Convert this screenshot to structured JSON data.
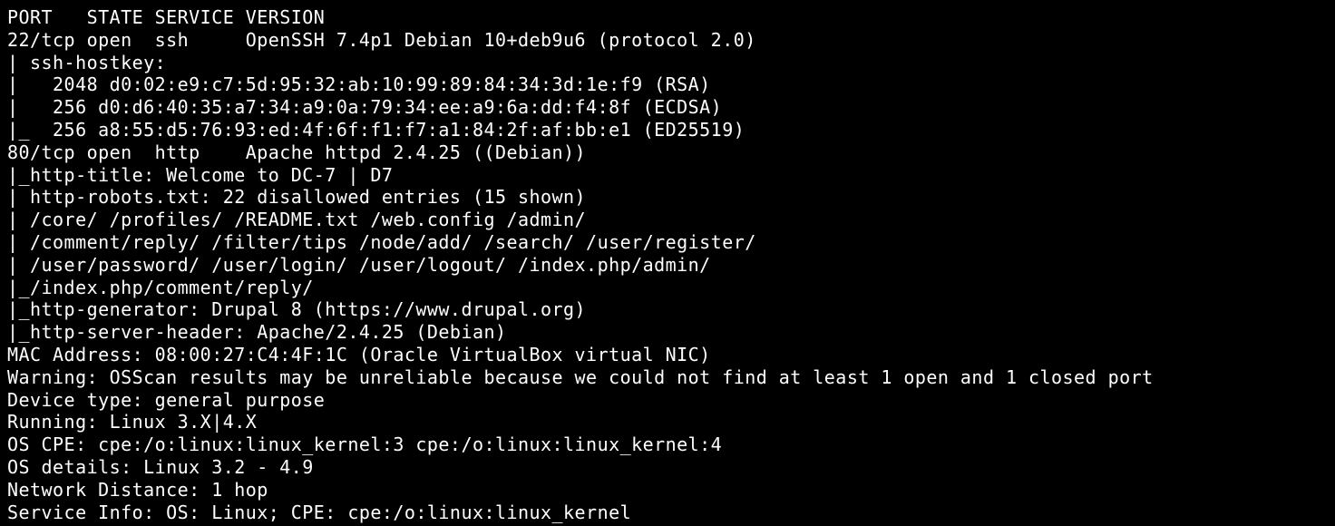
{
  "terminal": {
    "lines": [
      "PORT   STATE SERVICE VERSION",
      "22/tcp open  ssh     OpenSSH 7.4p1 Debian 10+deb9u6 (protocol 2.0)",
      "| ssh-hostkey: ",
      "|   2048 d0:02:e9:c7:5d:95:32:ab:10:99:89:84:34:3d:1e:f9 (RSA)",
      "|   256 d0:d6:40:35:a7:34:a9:0a:79:34:ee:a9:6a:dd:f4:8f (ECDSA)",
      "|_  256 a8:55:d5:76:93:ed:4f:6f:f1:f7:a1:84:2f:af:bb:e1 (ED25519)",
      "80/tcp open  http    Apache httpd 2.4.25 ((Debian))",
      "|_http-title: Welcome to DC-7 | D7",
      "| http-robots.txt: 22 disallowed entries (15 shown)",
      "| /core/ /profiles/ /README.txt /web.config /admin/ ",
      "| /comment/reply/ /filter/tips /node/add/ /search/ /user/register/ ",
      "| /user/password/ /user/login/ /user/logout/ /index.php/admin/ ",
      "|_/index.php/comment/reply/",
      "|_http-generator: Drupal 8 (https://www.drupal.org)",
      "|_http-server-header: Apache/2.4.25 (Debian)",
      "MAC Address: 08:00:27:C4:4F:1C (Oracle VirtualBox virtual NIC)",
      "Warning: OSScan results may be unreliable because we could not find at least 1 open and 1 closed port",
      "Device type: general purpose",
      "Running: Linux 3.X|4.X",
      "OS CPE: cpe:/o:linux:linux_kernel:3 cpe:/o:linux:linux_kernel:4",
      "OS details: Linux 3.2 - 4.9",
      "Network Distance: 1 hop",
      "Service Info: OS: Linux; CPE: cpe:/o:linux:linux_kernel"
    ]
  },
  "colors": {
    "background": "#000000",
    "foreground": "#ffffff"
  }
}
